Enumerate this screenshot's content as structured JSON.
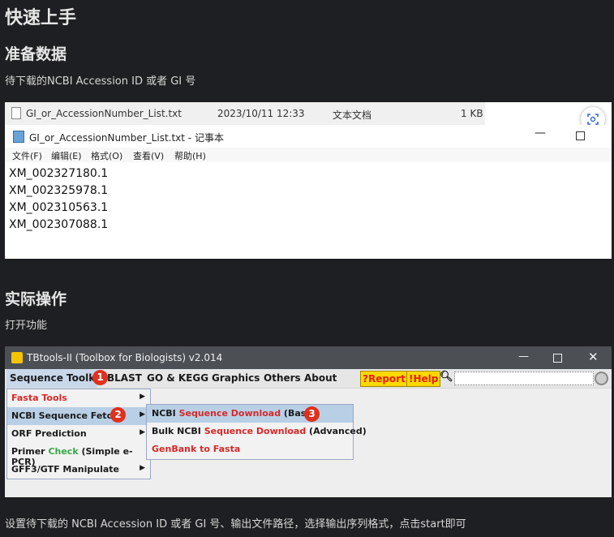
{
  "doc": {
    "title": "快速上手",
    "section1": {
      "heading": "准备数据",
      "desc": "待下载的NCBI  Accession ID 或者 GI 号"
    },
    "section2": {
      "heading": "实际操作",
      "desc": "打开功能"
    },
    "footer": "设置待下载的 NCBI  Accession ID 或者 GI 号、输出文件路径，选择输出序列格式，点击start即可"
  },
  "file_row": {
    "name": "GI_or_AccessionNumber_List.txt",
    "date": "2023/10/11 12:33",
    "type": "文本文档",
    "size": "1 KB"
  },
  "notepad": {
    "title": "GI_or_AccessionNumber_List.txt - 记事本",
    "menu": [
      "文件(F)",
      "编辑(E)",
      "格式(O)",
      "查看(V)",
      "帮助(H)"
    ],
    "lines": [
      "XM_002327180.1",
      "XM_002325978.1",
      "XM_002310563.1",
      "XM_002307088.1"
    ]
  },
  "tbtools": {
    "title": "TBtools-II (Toolbox for Biologists) v2.014",
    "menubar": [
      "Sequence Toolkit",
      "BLAST",
      "GO & KEGG",
      "Graphics",
      "Others",
      "About"
    ],
    "report": "?Report",
    "help": "!Help",
    "menu1": {
      "fasta": "Fasta Tools",
      "ncbi": "NCBI Sequence Fetch",
      "orf": "ORF Prediction",
      "primer_a": "Primer ",
      "primer_b": "Check",
      "primer_c": " (Simple e-PCR)",
      "gff": "GFF3/GTF Manipulate"
    },
    "menu2": {
      "r1a": "NCBI ",
      "r1b": "Sequence Download",
      "r1c": " (Basic)",
      "r2a": "Bulk NCBI ",
      "r2b": "Sequence Download",
      "r2c": " (Advanced)",
      "r3": "GenBank to Fasta"
    },
    "badges": [
      "1",
      "2",
      "3"
    ]
  }
}
